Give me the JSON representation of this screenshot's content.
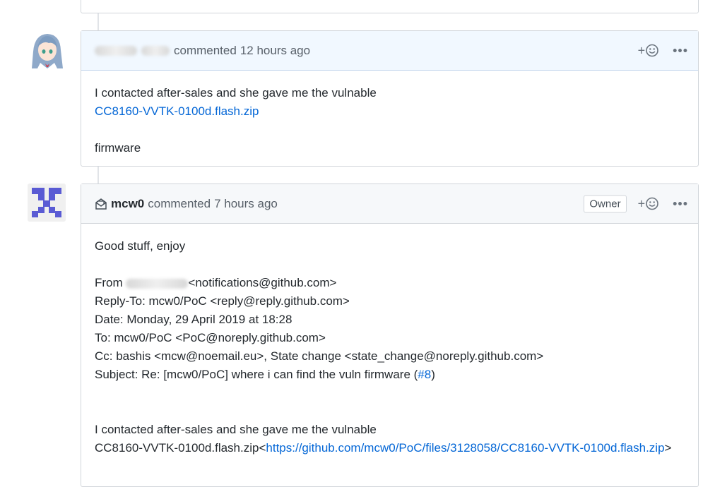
{
  "comment1": {
    "action_text": "commented",
    "time": "12 hours ago",
    "body_line1": "I contacted after-sales and she gave me the vulnable",
    "attachment_link": "CC8160-VVTK-0100d.flash.zip",
    "body_line3": "firmware"
  },
  "comment2": {
    "author": "mcw0",
    "action_text": "commented",
    "time": "7 hours ago",
    "badge": "Owner",
    "greeting": "Good stuff, enjoy",
    "from_prefix": "From",
    "from_email": "<notifications@github.com>",
    "reply_to": "Reply-To: mcw0/PoC <reply@reply.github.com>",
    "date": "Date: Monday, 29 April 2019 at 18:28",
    "to": "To: mcw0/PoC <PoC@noreply.github.com>",
    "cc": "Cc: bashis <mcw@noemail.eu>, State change <state_change@noreply.github.com>",
    "subject_prefix": "Subject: Re: [mcw0/PoC] where i can find the vuln firmware (",
    "subject_issue": "#8",
    "subject_suffix": ")",
    "quote_line1": "I contacted after-sales and she gave me the vulnable",
    "quote_file": "CC8160-VVTK-0100d.flash.zip",
    "quote_lt": "<",
    "quote_url": "https://github.com/mcw0/PoC/files/3128058/CC8160-VVTK-0100d.flash.zip",
    "quote_gt": ">"
  },
  "icons": {
    "add_reaction": "plus-smiley-icon",
    "more": "kebab-horizontal-icon",
    "email": "mail-read-icon"
  },
  "colors": {
    "link": "#0366d6",
    "header_blue_bg": "#f1f8ff",
    "header_gray_bg": "#f6f8fa",
    "identicon": "#5a5bd4"
  }
}
